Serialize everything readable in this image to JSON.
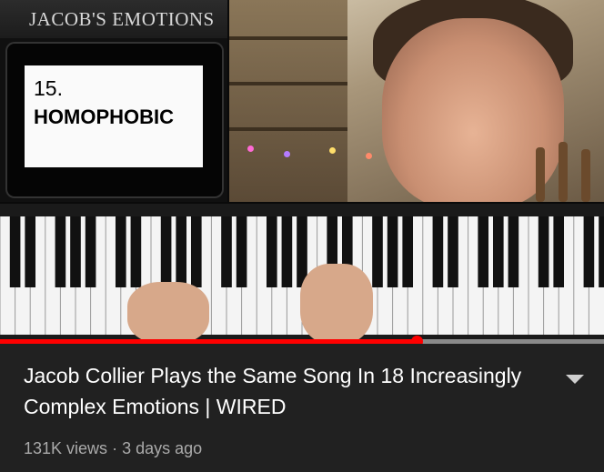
{
  "video": {
    "overlay_title": "JACOB'S EMOTIONS",
    "emotion_number": "15.",
    "emotion_name": "HOMOPHOBIC",
    "progress_fraction": 0.69
  },
  "info": {
    "title": "Jacob Collier Plays the Same Song In 18 Increasingly Complex Emotions | WIRED",
    "views": "131K views",
    "separator": "·",
    "age": "3 days ago"
  },
  "icons": {
    "expand": "chevron-down-icon"
  },
  "colors": {
    "progress": "#ff0000",
    "background": "#212121"
  }
}
